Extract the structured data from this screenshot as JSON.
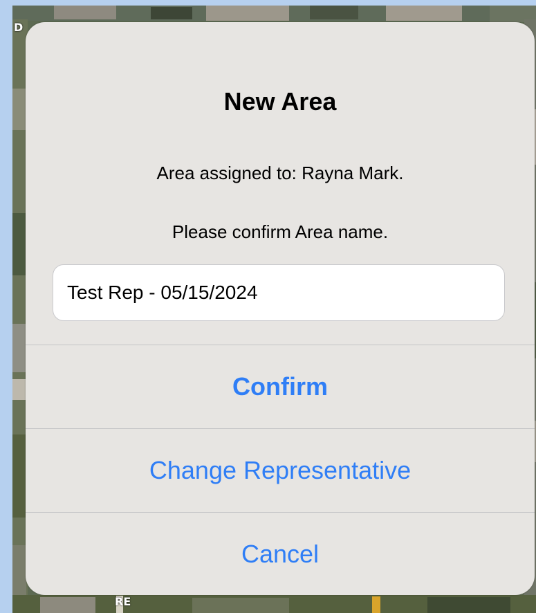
{
  "dialog": {
    "title": "New Area",
    "message_assigned": "Area assigned to: Rayna Mark.",
    "message_confirm": "Please confirm Area name.",
    "area_name_value": "Test Rep - 05/15/2024"
  },
  "actions": {
    "confirm_label": "Confirm",
    "change_rep_label": "Change Representative",
    "cancel_label": "Cancel"
  },
  "colors": {
    "accent": "#2f7ef6",
    "dialog_background": "#e7e5e2",
    "page_frame": "#b6d0ef"
  },
  "map": {
    "road_label_top": "D",
    "road_label_bottom": "RE"
  }
}
